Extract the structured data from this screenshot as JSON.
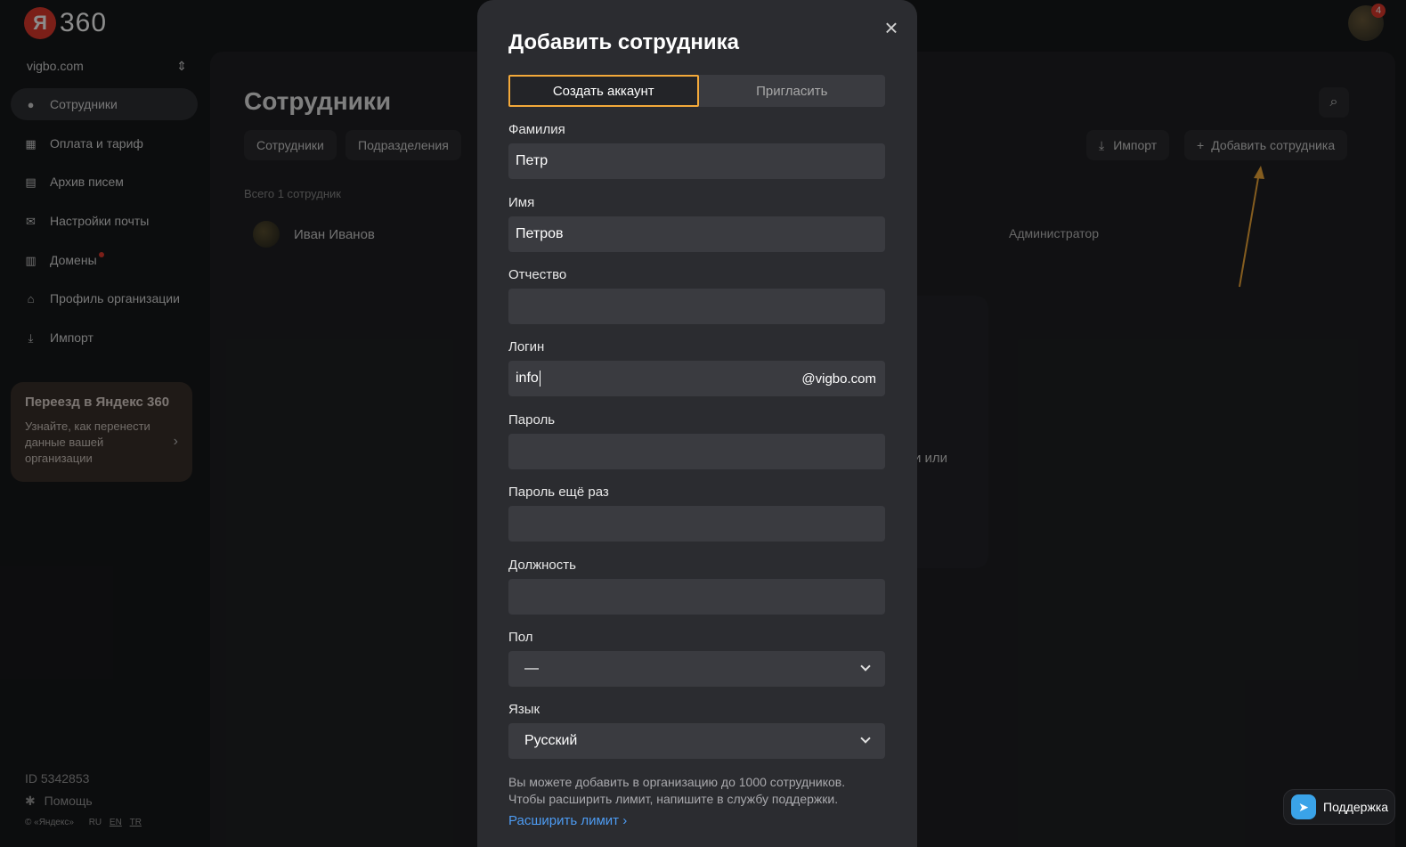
{
  "topbar": {
    "logo_mark": "Я",
    "logo_text": "360",
    "notifications": "4"
  },
  "sidebar": {
    "org": "vigbo.com",
    "items": [
      {
        "label": "Сотрудники",
        "icon": "person-icon"
      },
      {
        "label": "Оплата и тариф",
        "icon": "grid-icon"
      },
      {
        "label": "Архив писем",
        "icon": "archive-lock-icon"
      },
      {
        "label": "Настройки почты",
        "icon": "mail-icon"
      },
      {
        "label": "Домены",
        "icon": "domains-icon"
      },
      {
        "label": "Профиль организации",
        "icon": "home-icon"
      },
      {
        "label": "Импорт",
        "icon": "import-icon"
      }
    ],
    "promo": {
      "title": "Переезд в Яндекс 360",
      "text": "Узнайте, как перенести данные вашей организации"
    },
    "org_id": "ID 5342853",
    "help": "Помощь",
    "copyright": "© «Яндекс»",
    "langs": [
      "RU",
      "EN",
      "TR"
    ]
  },
  "main": {
    "title": "Сотрудники",
    "tabs": [
      "Сотрудники",
      "Подразделения"
    ],
    "import_label": "Импорт",
    "add_label": "Добавить сотрудника",
    "count": "Всего 1 сотрудник",
    "employee": {
      "name": "Иван Иванов",
      "role": "Администратор"
    },
    "ghost_text": "и или"
  },
  "modal": {
    "title": "Добавить сотрудника",
    "tabs": {
      "create": "Создать аккаунт",
      "invite": "Пригласить"
    },
    "fields": {
      "last_name": {
        "label": "Фамилия",
        "value": "Петр"
      },
      "first_name": {
        "label": "Имя",
        "value": "Петров"
      },
      "middle_name": {
        "label": "Отчество",
        "value": ""
      },
      "login": {
        "label": "Логин",
        "value": "info",
        "suffix": "@vigbo.com"
      },
      "password": {
        "label": "Пароль",
        "value": ""
      },
      "password_repeat": {
        "label": "Пароль ещё раз",
        "value": ""
      },
      "position": {
        "label": "Должность",
        "value": ""
      },
      "gender": {
        "label": "Пол",
        "value": "—"
      },
      "language": {
        "label": "Язык",
        "value": "Русский"
      }
    },
    "note": "Вы можете добавить в организацию до 1000 сотрудников. Чтобы расширить лимит, напишите в службу поддержки.",
    "link": "Расширить лимит"
  },
  "support": {
    "label": "Поддержка"
  },
  "colors": {
    "accent": "#f3a93a",
    "link": "#4d9bf2",
    "brand": "#e03a2d"
  }
}
